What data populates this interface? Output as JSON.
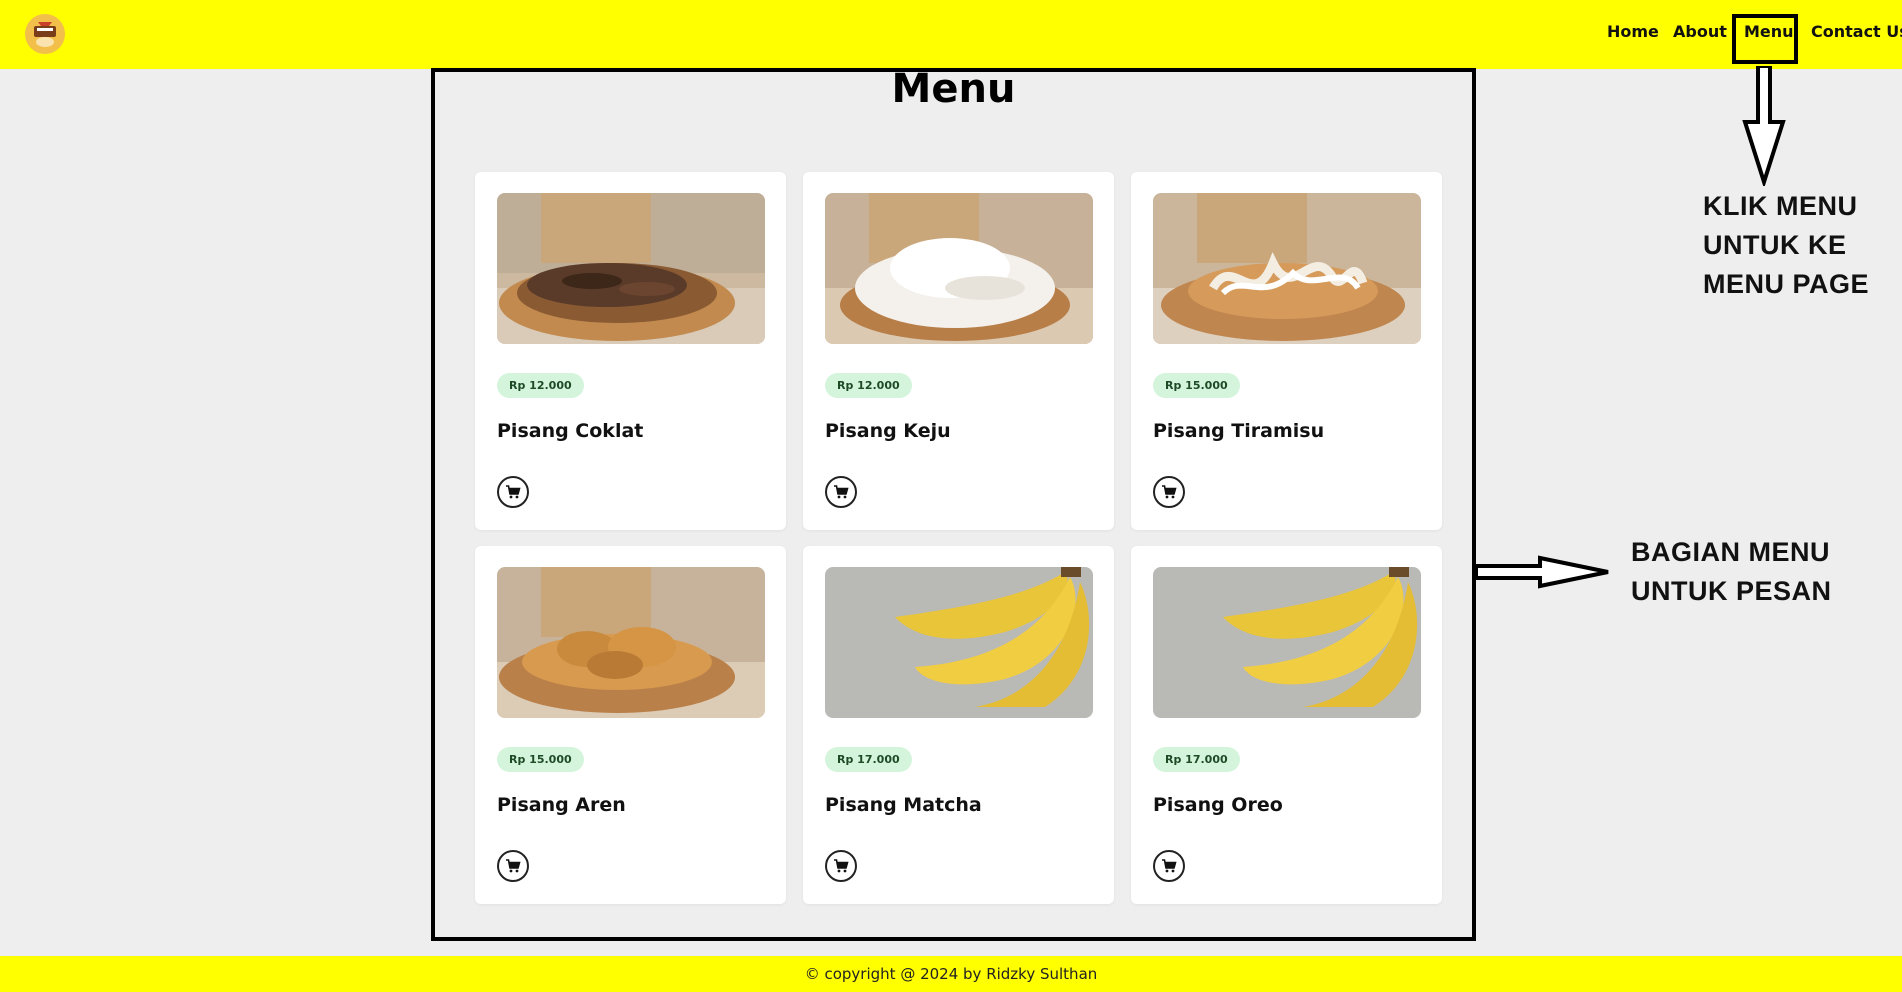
{
  "header": {
    "logo": "pisang-logo",
    "nav": [
      {
        "label": "Home"
      },
      {
        "label": "About"
      },
      {
        "label": "Menu"
      },
      {
        "label": "Contact Us"
      }
    ]
  },
  "main": {
    "title": "Menu",
    "items": [
      {
        "price": "Rp 12.000",
        "name": "Pisang Coklat",
        "image": "chocolate-banana-photo"
      },
      {
        "price": "Rp 12.000",
        "name": "Pisang Keju",
        "image": "cheese-banana-photo"
      },
      {
        "price": "Rp 15.000",
        "name": "Pisang Tiramisu",
        "image": "tiramisu-banana-photo"
      },
      {
        "price": "Rp 15.000",
        "name": "Pisang Aren",
        "image": "aren-banana-photo"
      },
      {
        "price": "Rp 17.000",
        "name": "Pisang Matcha",
        "image": "banana-bunch-photo"
      },
      {
        "price": "Rp 17.000",
        "name": "Pisang Oreo",
        "image": "banana-bunch-photo"
      }
    ]
  },
  "footer": {
    "text": "© copyright @ 2024 by Ridzky Sulthan"
  },
  "annotations": {
    "menu_note": [
      "KLIK MENU",
      "UNTUK KE",
      "MENU PAGE"
    ],
    "section_note": [
      "BAGIAN MENU",
      "UNTUK PESAN"
    ]
  },
  "colors": {
    "header_bg": "#ffff00",
    "page_bg": "#eeeeee",
    "price_badge_bg": "#d4f5dc",
    "frame_border": "#000000"
  }
}
